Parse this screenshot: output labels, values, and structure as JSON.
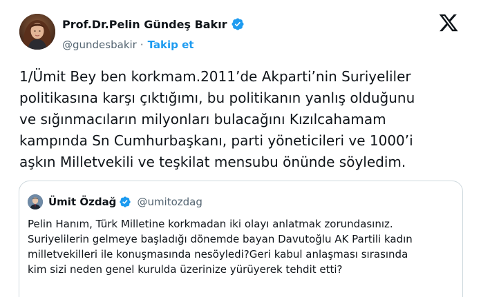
{
  "tweet": {
    "author": {
      "display_name": "Prof.Dr.Pelin Gündeş Bakır",
      "handle": "@gundesbakir",
      "separator": "·",
      "follow_label": "Takip et",
      "verified": true,
      "avatar_icon": "profile-photo"
    },
    "platform_icon": "x-logo-icon",
    "text": "1/Ümit Bey ben korkmam.2011’de Akparti’nin Suriyeliler\npolitikasına karşı çıktığımı, bu politikanın yanlış olduğunu\nve sığınmacıların milyonları bulacağını Kızılcahamam\nkampında Sn Cumhurbaşkanı, parti yöneticileri ve 1000’i\naşkın Milletvekili ve teşkilat mensubu önünde söyledim."
  },
  "quoted_tweet": {
    "author": {
      "display_name": "Ümit Özdağ",
      "handle": "@umitozdag",
      "verified": true,
      "avatar_icon": "profile-photo"
    },
    "text": "Pelin Hanım, Türk Milletine korkmadan iki olayı anlatmak zorundasınız.\nSuriyelilerin gelmeye başladığı dönemde bayan Davutoğlu AK Partili kadın\nmilletvekilleri ile konuşmasında nesöyledi?Geri kabul anlaşması sırasında\nkim sizi neden genel kurulda üzerinize yürüyerek tehdit etti?"
  },
  "colors": {
    "text_primary": "#0f1419",
    "text_secondary": "#536471",
    "accent": "#1d9bf0",
    "border": "#cfd9de",
    "background": "#ffffff"
  }
}
